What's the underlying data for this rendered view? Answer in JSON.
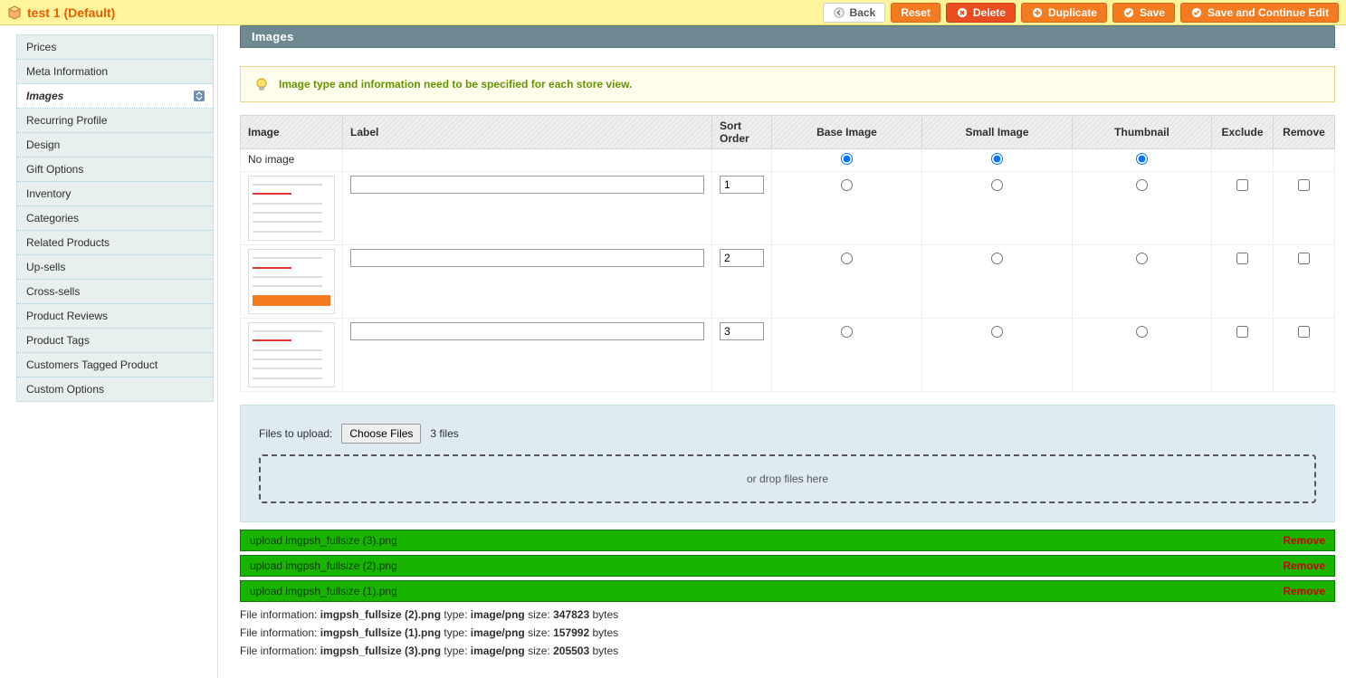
{
  "header": {
    "title": "test 1 (Default)",
    "buttons": {
      "back": "Back",
      "reset": "Reset",
      "delete": "Delete",
      "duplicate": "Duplicate",
      "save": "Save",
      "save_continue": "Save and Continue Edit"
    }
  },
  "sidebar": {
    "items": [
      {
        "label": "Prices",
        "active": false
      },
      {
        "label": "Meta Information",
        "active": false
      },
      {
        "label": "Images",
        "active": true
      },
      {
        "label": "Recurring Profile",
        "active": false
      },
      {
        "label": "Design",
        "active": false
      },
      {
        "label": "Gift Options",
        "active": false
      },
      {
        "label": "Inventory",
        "active": false
      },
      {
        "label": "Categories",
        "active": false
      },
      {
        "label": "Related Products",
        "active": false
      },
      {
        "label": "Up-sells",
        "active": false
      },
      {
        "label": "Cross-sells",
        "active": false
      },
      {
        "label": "Product Reviews",
        "active": false
      },
      {
        "label": "Product Tags",
        "active": false
      },
      {
        "label": "Customers Tagged Product",
        "active": false
      },
      {
        "label": "Custom Options",
        "active": false
      }
    ]
  },
  "section": {
    "title": "Images"
  },
  "notice": "Image type and information need to be specified for each store view.",
  "table": {
    "headers": {
      "image": "Image",
      "label": "Label",
      "sort_order": "Sort Order",
      "base_image": "Base Image",
      "small_image": "Small Image",
      "thumbnail": "Thumbnail",
      "exclude": "Exclude",
      "remove": "Remove"
    },
    "no_image_label": "No image",
    "rows": [
      {
        "sort_order": "1",
        "label": "",
        "base": false,
        "small": false,
        "thumb": false,
        "exclude": false,
        "remove": false,
        "orange_stripe": false
      },
      {
        "sort_order": "2",
        "label": "",
        "base": false,
        "small": false,
        "thumb": false,
        "exclude": false,
        "remove": false,
        "orange_stripe": true
      },
      {
        "sort_order": "3",
        "label": "",
        "base": false,
        "small": false,
        "thumb": false,
        "exclude": false,
        "remove": false,
        "orange_stripe": false
      }
    ]
  },
  "upload": {
    "files_to_upload_label": "Files to upload:",
    "choose_files_label": "Choose Files",
    "file_count_text": "3 files",
    "dropzone_text": "or drop files here"
  },
  "uploaded": [
    {
      "status": "upload",
      "name": "imgpsh_fullsize (3).png",
      "remove": "Remove"
    },
    {
      "status": "upload",
      "name": "imgpsh_fullsize (2).png",
      "remove": "Remove"
    },
    {
      "status": "upload",
      "name": "imgpsh_fullsize (1).png",
      "remove": "Remove"
    }
  ],
  "file_info_label_prefix": "File information: ",
  "file_info_type_label": " type: ",
  "file_info_size_label": " size: ",
  "file_info_bytes_label": " bytes",
  "file_info": [
    {
      "name": "imgpsh_fullsize (2).png",
      "type": "image/png",
      "size": "347823"
    },
    {
      "name": "imgpsh_fullsize (1).png",
      "type": "image/png",
      "size": "157992"
    },
    {
      "name": "imgpsh_fullsize (3).png",
      "type": "image/png",
      "size": "205503"
    }
  ]
}
